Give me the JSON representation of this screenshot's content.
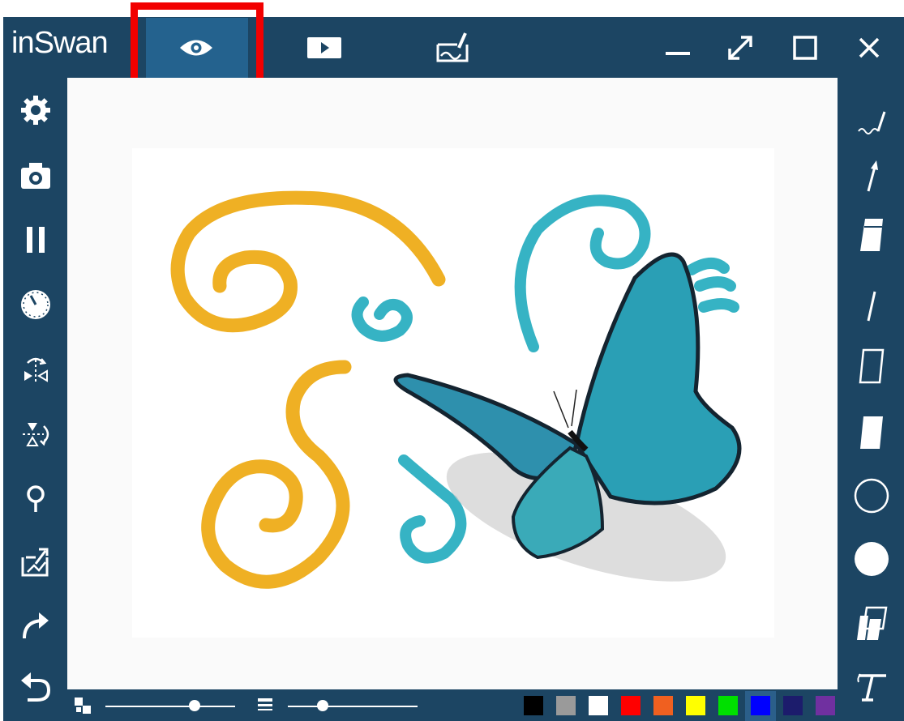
{
  "app": {
    "logo": "inSwan"
  },
  "titlebar": {
    "tabs": [
      {
        "name": "preview",
        "icon": "eye-icon",
        "active": true
      },
      {
        "name": "play",
        "icon": "play-icon",
        "active": false
      },
      {
        "name": "draw",
        "icon": "board-pen-icon",
        "active": false
      }
    ],
    "window_controls": [
      "minimize-icon",
      "expand-icon",
      "maximize-icon",
      "close-icon"
    ]
  },
  "left_toolbar": [
    "gear-icon",
    "camera-icon",
    "pause-icon",
    "timer-icon",
    "flip-horizontal-icon",
    "flip-vertical-icon",
    "magnifier-icon",
    "board-icon",
    "redo-icon",
    "undo-icon"
  ],
  "right_toolbar": [
    "freehand-pen-icon",
    "arrow-icon",
    "eraser-icon",
    "line-icon",
    "rectangle-outline-icon",
    "rectangle-filled-icon",
    "circle-outline-icon",
    "circle-filled-icon",
    "clear-eraser-icon",
    "text-icon"
  ],
  "bottom_bar": {
    "opacity_slider_value": 0.69,
    "thickness_slider_value": 0.27,
    "colors": [
      "#000000",
      "#9a9a9a",
      "#ffffff",
      "#ff0000",
      "#f06020",
      "#ffff00",
      "#00e000",
      "#0000ff",
      "#1c1c6c",
      "#7030a0"
    ],
    "selected_color": "#0000ff"
  },
  "highlight_color": "#f20000"
}
